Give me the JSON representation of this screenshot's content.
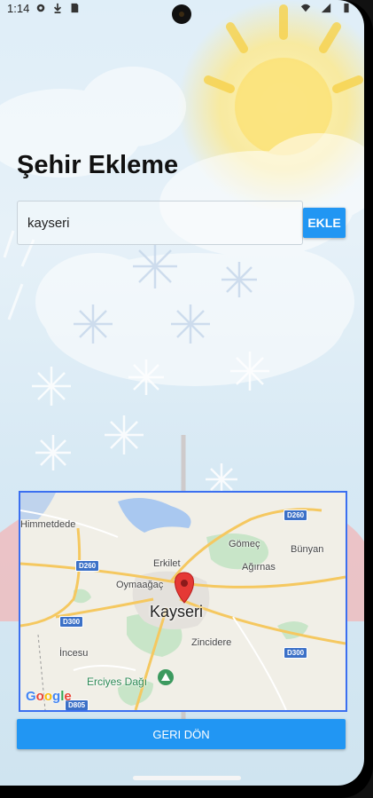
{
  "status_bar": {
    "time": "1:14",
    "icons": [
      "gear-icon",
      "download-icon",
      "sd-card-icon"
    ],
    "right_icons": [
      "wifi-icon",
      "signal-icon",
      "battery-icon"
    ]
  },
  "page": {
    "title": "Şehir Ekleme",
    "city_input_value": "kayseri",
    "add_button_label": "EKLE",
    "back_button_label": "GERI DÖN"
  },
  "map": {
    "center_city": "Kayseri",
    "places": [
      "Himmetdede",
      "Gömeç",
      "Bünyan",
      "Erkilet",
      "Ağırnas",
      "Oymaağaç",
      "Zincidere",
      "İncesu"
    ],
    "poi": "Erciyes Dağı",
    "roads": [
      "D260",
      "D260",
      "D300",
      "D300",
      "D805"
    ],
    "attribution": "Google"
  },
  "colors": {
    "accent": "#2196f3",
    "map_border": "#3b6ff0",
    "road_badge": "#3b70c7"
  }
}
